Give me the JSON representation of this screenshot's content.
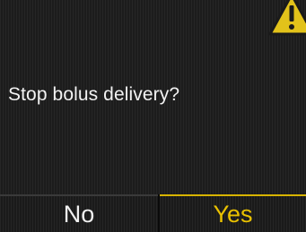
{
  "dialog": {
    "message": "Stop bolus delivery?",
    "icon": "warning-icon"
  },
  "softkeys": {
    "left_label": "No",
    "right_label": "Yes"
  },
  "colors": {
    "text": "#f2f2f2",
    "accent": "#e9c100",
    "background": "#1e1e1e"
  }
}
